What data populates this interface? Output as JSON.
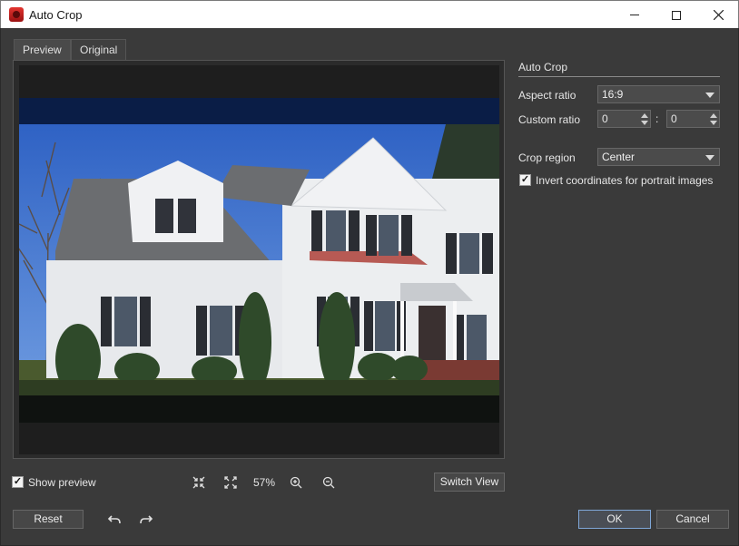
{
  "window": {
    "title": "Auto Crop",
    "icon": "app-icon",
    "controls": [
      "minimize-icon",
      "maximize-icon",
      "close-icon"
    ]
  },
  "tabs": [
    {
      "label": "Preview",
      "active": true
    },
    {
      "label": "Original",
      "active": false
    }
  ],
  "settings": {
    "section_title": "Auto Crop",
    "aspect_ratio": {
      "label": "Aspect ratio",
      "value": "16:9"
    },
    "custom_ratio": {
      "label": "Custom ratio",
      "value_a": "0",
      "separator": ":",
      "value_b": "0"
    },
    "crop_region": {
      "label": "Crop region",
      "value": "Center"
    },
    "invert": {
      "label": "Invert coordinates for portrait images",
      "checked": true
    }
  },
  "preview_toolbar": {
    "show_preview": {
      "label": "Show preview",
      "checked": true
    },
    "icons": [
      "fit-to-window-icon",
      "actual-size-icon",
      "zoom-in-icon",
      "zoom-out-icon"
    ],
    "zoom": "57%",
    "switch_view": "Switch View"
  },
  "footer": {
    "reset": "Reset",
    "ok": "OK",
    "cancel": "Cancel",
    "icons": [
      "undo-icon",
      "redo-icon"
    ]
  },
  "colors": {
    "background": "#3a3a3a",
    "ok_border": "#7fa7d8",
    "crop_band_top": "#0a1d46"
  }
}
